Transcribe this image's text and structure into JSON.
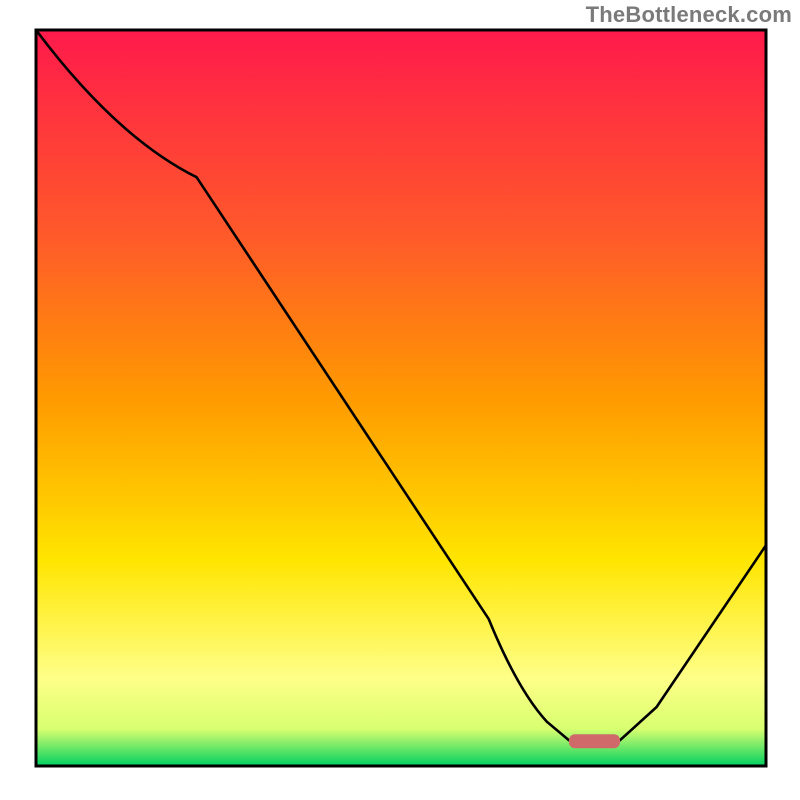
{
  "watermark": "TheBottleneck.com",
  "chart_data": {
    "type": "line",
    "title": "",
    "xlabel": "",
    "ylabel": "",
    "xlim": [
      0,
      100
    ],
    "ylim": [
      0,
      100
    ],
    "background_gradient": {
      "top": "#ff1a4b",
      "mid1": "#ff8a00",
      "mid2": "#ffe500",
      "low": "#ffff99",
      "bottom": "#00d060"
    },
    "curve_points": [
      {
        "x": 0,
        "y": 100
      },
      {
        "x": 22,
        "y": 80
      },
      {
        "x": 62,
        "y": 20
      },
      {
        "x": 70,
        "y": 6
      },
      {
        "x": 73,
        "y": 3.5
      },
      {
        "x": 80,
        "y": 3.5
      },
      {
        "x": 85,
        "y": 8
      },
      {
        "x": 100,
        "y": 30
      }
    ],
    "flat_segment": {
      "x_start": 73,
      "x_end": 80,
      "y": 3.5
    },
    "marker": {
      "shape": "rounded-bar",
      "color": "#d06a6a",
      "x_start": 73,
      "x_end": 80,
      "y": 3.5
    },
    "frame": {
      "stroke": "#000000",
      "width": 2.5
    }
  }
}
